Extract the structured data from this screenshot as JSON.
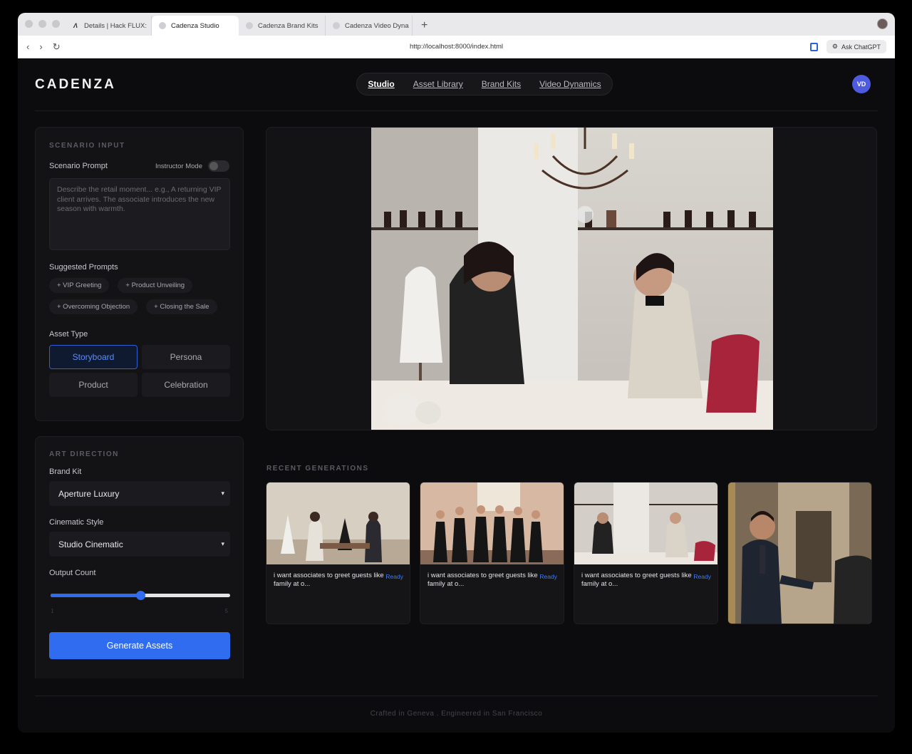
{
  "browser": {
    "tabs": [
      {
        "title": "Details | Hack FLUX:",
        "favicon": "hack-flux-logo"
      },
      {
        "title": "Cadenza Studio",
        "favicon": "globe-icon",
        "active": true
      },
      {
        "title": "Cadenza Brand Kits",
        "favicon": "globe-icon"
      },
      {
        "title": "Cadenza Video Dyna",
        "favicon": "globe-icon"
      }
    ],
    "new_tab": "+",
    "url": "http://localhost:8000/index.html",
    "ask_chatgpt": "Ask ChatGPT"
  },
  "app": {
    "logo": "CADENZA",
    "nav": [
      "Studio",
      "Asset Library",
      "Brand Kits",
      "Video Dynamics"
    ],
    "active_nav": "Studio",
    "avatar": "VD"
  },
  "scenario": {
    "title": "SCENARIO INPUT",
    "prompt_label": "Scenario Prompt",
    "instructor_mode": "Instructor Mode",
    "instructor_on": false,
    "placeholder": "Describe the retail moment... e.g., A returning VIP client arrives. The associate introduces the new season with warmth.",
    "suggested_label": "Suggested Prompts",
    "suggested": [
      "+ VIP Greeting",
      "+ Product Unveiling",
      "+ Overcoming Objection",
      "+ Closing the Sale"
    ],
    "asset_type_label": "Asset Type",
    "asset_types": [
      "Storyboard",
      "Persona",
      "Product",
      "Celebration"
    ],
    "selected_asset_type": "Storyboard"
  },
  "art_direction": {
    "title": "ART DIRECTION",
    "brand_kit_label": "Brand Kit",
    "brand_kit": "Aperture Luxury",
    "style_label": "Cinematic Style",
    "style": "Studio Cinematic",
    "output_label": "Output Count",
    "output_min": "1",
    "output_max": "5",
    "output_value": 3,
    "generate": "Generate Assets"
  },
  "recent": {
    "title": "RECENT GENERATIONS",
    "items": [
      {
        "caption": "i want associates to greet guests like family at o...",
        "status": "Ready"
      },
      {
        "caption": "i want associates to greet guests like family at o...",
        "status": "Ready"
      },
      {
        "caption": "i want associates to greet guests like family at o...",
        "status": "Ready"
      },
      {
        "caption": "",
        "status": ""
      }
    ]
  },
  "footer": "Crafted in Geneva . Engineered in San Francisco",
  "colors": {
    "accent": "#2f6cf0",
    "avatar": "#4e5be0",
    "background": "#0c0c0e"
  }
}
